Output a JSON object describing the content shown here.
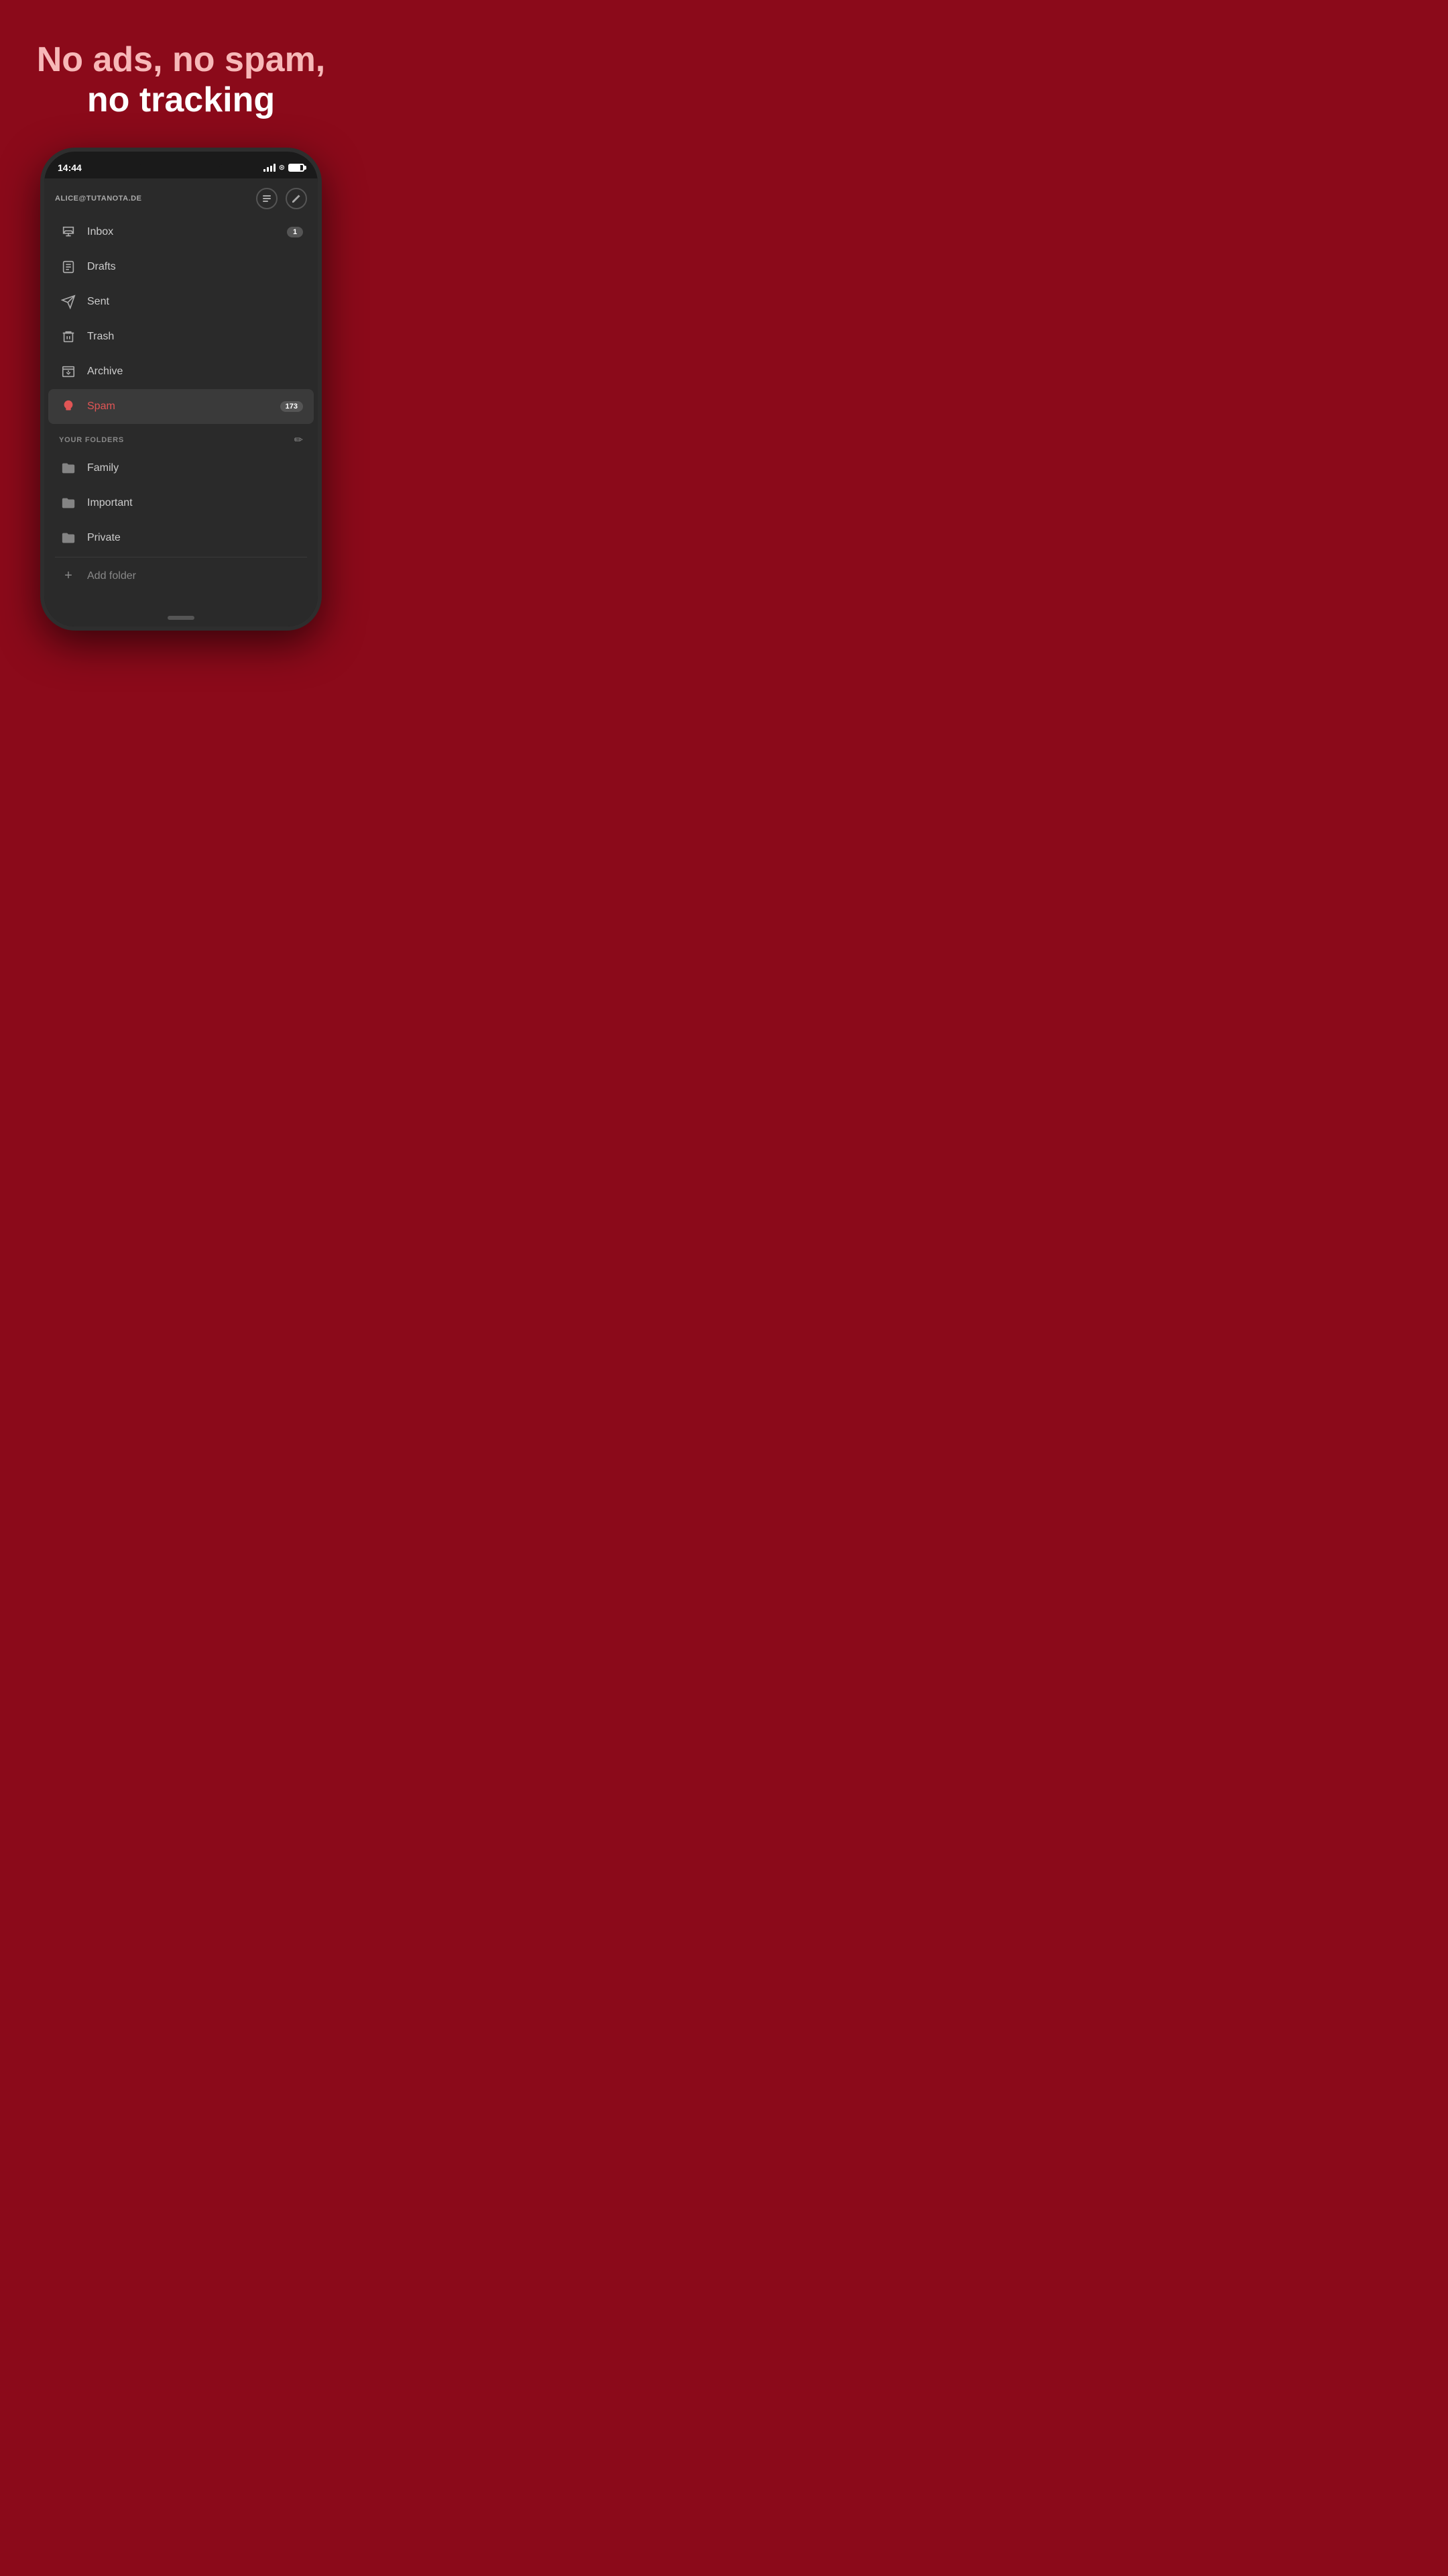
{
  "background_color": "#8B0A1A",
  "headline": {
    "line1": "No ads, no spam,",
    "line2": "no tracking"
  },
  "status_bar": {
    "time": "14:44"
  },
  "account": {
    "email": "ALICE@TUTANOTA.DE"
  },
  "nav_items": [
    {
      "id": "inbox",
      "label": "Inbox",
      "icon": "inbox",
      "badge": "1",
      "active": false
    },
    {
      "id": "drafts",
      "label": "Drafts",
      "icon": "drafts",
      "badge": null,
      "active": false
    },
    {
      "id": "sent",
      "label": "Sent",
      "icon": "sent",
      "badge": null,
      "active": false
    },
    {
      "id": "trash",
      "label": "Trash",
      "icon": "trash",
      "badge": null,
      "active": false
    },
    {
      "id": "archive",
      "label": "Archive",
      "icon": "archive",
      "badge": null,
      "active": false
    },
    {
      "id": "spam",
      "label": "Spam",
      "icon": "spam",
      "badge": "173",
      "active": true
    }
  ],
  "folders_section": {
    "title": "YOUR FOLDERS",
    "edit_icon": "pencil"
  },
  "folders": [
    {
      "id": "family",
      "label": "Family"
    },
    {
      "id": "important",
      "label": "Important"
    },
    {
      "id": "private",
      "label": "Private"
    }
  ],
  "add_folder_label": "Add folder"
}
